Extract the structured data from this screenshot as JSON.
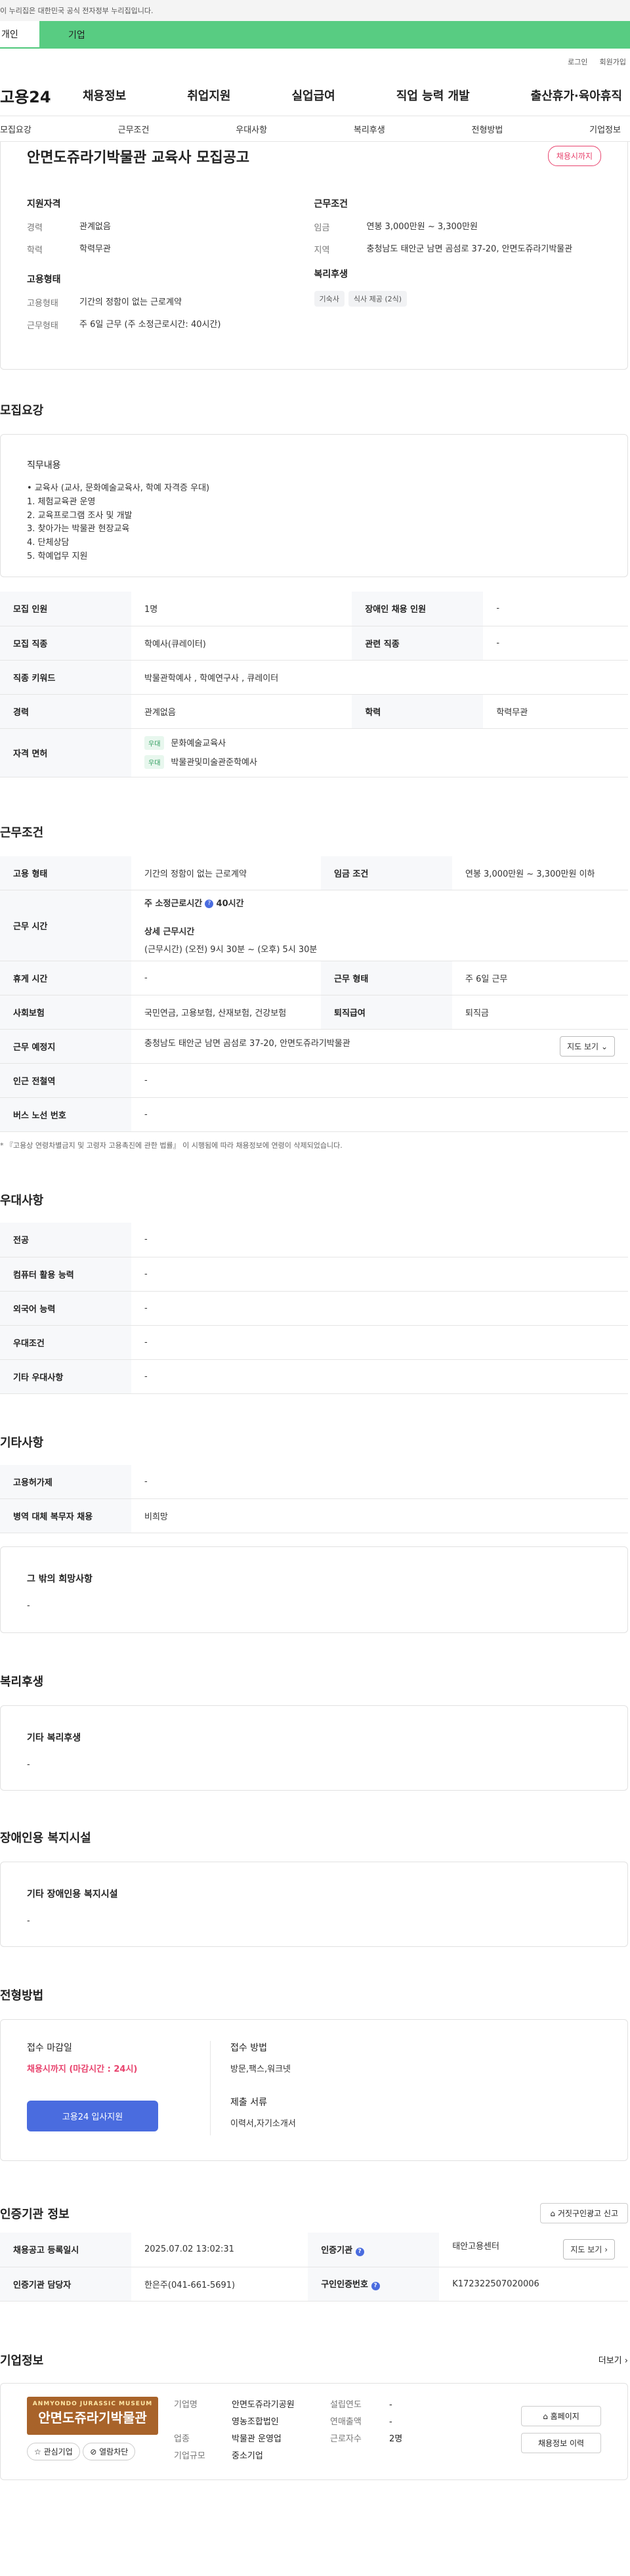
{
  "banner": {
    "text": "이 누리집은 대한민국 공식 전자정부 누리집입니다."
  },
  "top_tabs": {
    "left": "개인",
    "right": "기업"
  },
  "util": {
    "login": "로그인",
    "join": "회원가입"
  },
  "gnb": {
    "logo": "고용24",
    "items": [
      "채용정보",
      "취업지원",
      "실업급여",
      "직업 능력 개발",
      "출산휴가·육아휴직"
    ]
  },
  "subnav": [
    "모집요강",
    "근무조건",
    "우대사항",
    "복리후생",
    "전형방법",
    "기업정보"
  ],
  "summary": {
    "title": "안면도쥬라기박물관 교육사 모집공고",
    "badge": "채용시까지",
    "qual": {
      "heading": "지원자격",
      "career_k": "경력",
      "career_v": "관계없음",
      "edu_k": "학력",
      "edu_v": "학력무관"
    },
    "cond": {
      "heading": "근무조건",
      "wage_k": "임금",
      "wage_v": "연봉 3,000만원 ~ 3,300만원",
      "loc_k": "지역",
      "loc_v": "충청남도 태안군 남면 곰섬로 37-20, 안면도쥬라기박물관"
    },
    "emp": {
      "heading": "고용형태",
      "type_k": "고용형태",
      "type_v": "기간의 정함이 없는 근로계약",
      "form_k": "근무형태",
      "form_v": "주 6일 근무 (주 소정근로시간: 40시간)"
    },
    "welfare": {
      "heading": "복리후생",
      "chips": [
        "기숙사",
        "식사 제공 (2식)"
      ]
    }
  },
  "recruit": {
    "title": "모집요강",
    "duty_heading": "직무내용",
    "duty_lines": [
      "• 교육사 (교사, 문화예술교육사, 학예 자격증 우대)",
      "1. 체험교육관 운영",
      "2. 교육프로그램 조사 및 개발",
      "3. 찾아가는 박물관 현장교육",
      "4. 단체상담",
      "5. 학예업무 지원"
    ],
    "rows": {
      "count_k": "모집 인원",
      "count_v": "1명",
      "disabled_k": "장애인 채용 인원",
      "disabled_v": "-",
      "job_k": "모집 직종",
      "job_v": "학예사(큐레이터)",
      "related_k": "관련 직종",
      "related_v": "-",
      "kw_k": "직종 키워드",
      "kw_v": "박물관학예사 , 학예연구사 , 큐레이터",
      "career_k": "경력",
      "career_v": "관계없음",
      "edu_k": "학력",
      "edu_v": "학력무관",
      "license_k": "자격 면허",
      "license_tag": "우대",
      "license_1": "문화예술교육사",
      "license_2": "박물관및미술관준학예사"
    }
  },
  "work": {
    "title": "근무조건",
    "type_k": "고용 형태",
    "type_v": "기간의 정함이 없는 근로계약",
    "wage_k": "임금 조건",
    "wage_v": "연봉 3,000만원 ~ 3,300만원 이하",
    "hours_k": "근무 시간",
    "hours_label": "주 소정근로시간",
    "hours_value": "40시간",
    "detail_label": "상세 근무시간",
    "detail_value": "(근무시간) (오전) 9시 30분 ~ (오후) 5시 30분",
    "rest_k": "휴게 시간",
    "rest_v": "-",
    "form_k": "근무 형태",
    "form_v": "주 6일 근무",
    "ins_k": "사회보험",
    "ins_v": "국민연금, 고용보험, 산재보험, 건강보험",
    "retire_k": "퇴직급여",
    "retire_v": "퇴직금",
    "place_k": "근무 예정지",
    "place_v": "충청남도 태안군 남면 곰섬로 37-20, 안면도쥬라기박물관",
    "map_btn": "지도 보기",
    "subway_k": "인근 전철역",
    "subway_v": "-",
    "bus_k": "버스 노선 번호",
    "bus_v": "-",
    "note": "* 『고용상 연령차별금지 및 고령자 고용촉진에 관한 법률』 이 시행됨에 따라 채용정보에 연령이 삭제되었습니다."
  },
  "pref": {
    "title": "우대사항",
    "rows": [
      [
        "전공",
        "-"
      ],
      [
        "컴퓨터 활용 능력",
        "-"
      ],
      [
        "외국어 능력",
        "-"
      ],
      [
        "우대조건",
        "-"
      ],
      [
        "기타 우대사항",
        "-"
      ]
    ]
  },
  "etc": {
    "title": "기타사항",
    "rows": [
      [
        "고용허가제",
        "-"
      ],
      [
        "병역 대체 복무자 채용",
        "비희망"
      ]
    ],
    "other_heading": "그 밖의 희망사항",
    "other_value": "-"
  },
  "welfare": {
    "title": "복리후생",
    "heading": "기타 복리후생",
    "value": "-"
  },
  "disabled_fac": {
    "title": "장애인용 복지시설",
    "heading": "기타 장애인용 복지시설",
    "value": "-"
  },
  "process": {
    "title": "전형방법",
    "deadline_h": "접수 마감일",
    "deadline_v": "채용시까지 (마감시간 : 24시)",
    "method_h": "접수 방법",
    "method_v": "방문,팩스,워크넷",
    "docs_h": "제출 서류",
    "docs_v": "이력서,자기소개서",
    "apply_btn": "고용24 입사지원"
  },
  "cert": {
    "title": "인증기관 정보",
    "report_btn": "거짓구인광고 신고",
    "reg_k": "채용공고 등록일시",
    "reg_v": "2025.07.02 13:02:31",
    "org_k": "인증기관",
    "org_v": "태안고용센터",
    "map_btn": "지도 보기",
    "mgr_k": "인증기관 담당자",
    "mgr_v": "한은주(041-661-5691)",
    "no_k": "구인인증번호",
    "no_v": "K172322507020006"
  },
  "company": {
    "title": "기업정보",
    "more": "더보기",
    "logo_top": "ANMYONDO JURASSIC MUSEUM",
    "logo_main": "안면도쥬라기박물관",
    "fav_btn": "관심기업",
    "block_btn": "열람차단",
    "name_k": "기업명",
    "name_v1": "안면도쥬라기공원",
    "name_v2": "영농조합법인",
    "ind_k": "업종",
    "ind_v": "박물관 운영업",
    "size_k": "기업규모",
    "size_v": "중소기업",
    "year_k": "설립연도",
    "year_v": "-",
    "sales_k": "연매출액",
    "sales_v": "-",
    "emp_k": "근로자수",
    "emp_v": "2명",
    "home_btn": "홈페이지",
    "history_btn": "채용정보 이력"
  }
}
